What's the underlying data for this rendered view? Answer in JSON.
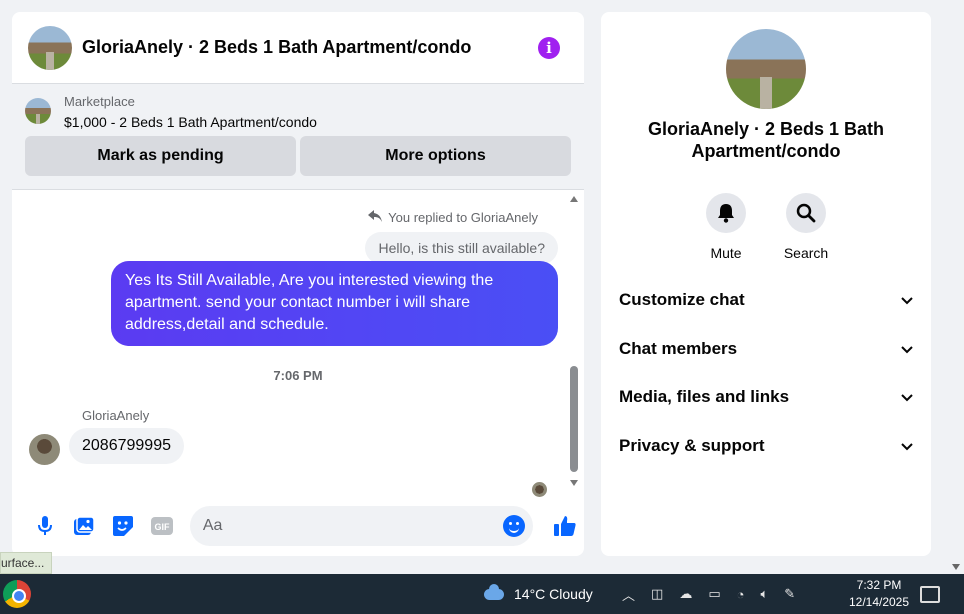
{
  "chat": {
    "header_title": "GloriaAnely · 2 Beds 1 Bath Apartment/condo",
    "marketplace": {
      "label": "Marketplace",
      "listing": "$1,000 - 2 Beds 1 Bath Apartment/condo",
      "mark_pending_label": "Mark as pending",
      "more_options_label": "More options"
    },
    "messages": {
      "replied_to": "You replied to GloriaAnely",
      "quoted_message": "Hello, is this still available?",
      "sent_message": "Yes Its Still Available, Are you interested viewing the apartment. send your contact number i will share address,detail and schedule.",
      "timestamp": "7:06 PM",
      "sender_name": "GloriaAnely",
      "received_message": "2086799995"
    },
    "composer": {
      "placeholder": "Aa",
      "icons": [
        "microphone-icon",
        "photo-icon",
        "sticker-icon",
        "gif-icon",
        "emoji-icon",
        "like-icon"
      ]
    }
  },
  "side_panel": {
    "title": "GloriaAnely · 2 Beds 1 Bath Apartment/condo",
    "actions": [
      {
        "label": "Mute",
        "icon": "bell-icon"
      },
      {
        "label": "Search",
        "icon": "search-icon"
      }
    ],
    "sections": [
      {
        "label": "Customize chat"
      },
      {
        "label": "Chat members"
      },
      {
        "label": "Media, files and links"
      },
      {
        "label": "Privacy & support"
      }
    ]
  },
  "status_pill": "urface...",
  "taskbar": {
    "weather": "14°C  Cloudy",
    "time": "7:32 PM",
    "date": "12/14/2025"
  },
  "colors": {
    "accent": "#0866ff",
    "sent_bubble": "#4f46f5",
    "info": "#a020f0"
  }
}
